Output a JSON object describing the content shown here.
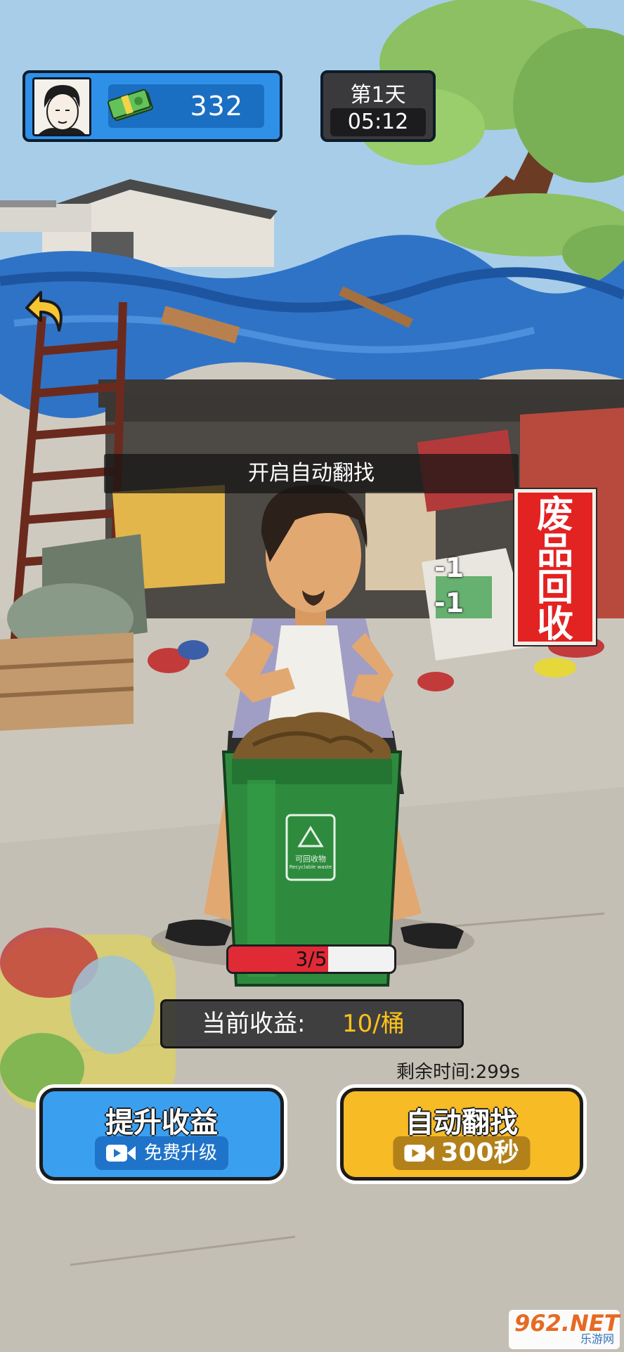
{
  "hud": {
    "money": "332",
    "day": "第1天",
    "time": "05:12"
  },
  "banner": "开启自动翻找",
  "sign": [
    "废",
    "品",
    "回",
    "收"
  ],
  "floating": [
    "-1",
    "-1"
  ],
  "bin": {
    "label_cn": "可回收物",
    "label_en": "Recyclable waste"
  },
  "progress": {
    "text": "3/5",
    "fraction": 0.6
  },
  "income": {
    "label": "当前收益:",
    "value": "10/桶"
  },
  "remaining": "剩余时间:299s",
  "buttons": {
    "upgrade": {
      "title": "提升收益",
      "sub": "免费升级"
    },
    "auto": {
      "title": "自动翻找",
      "sub": "300秒"
    }
  },
  "watermark": {
    "main": "962.NET",
    "sub": "乐游网"
  },
  "colors": {
    "sky": "#a8cde8",
    "accent_blue": "#3b9ff0",
    "accent_yellow": "#f6bb25",
    "progress_red": "#e02a36",
    "income_yellow": "#ffc21a",
    "sign_red": "#e32222",
    "bin_green": "#2e8b3e"
  }
}
